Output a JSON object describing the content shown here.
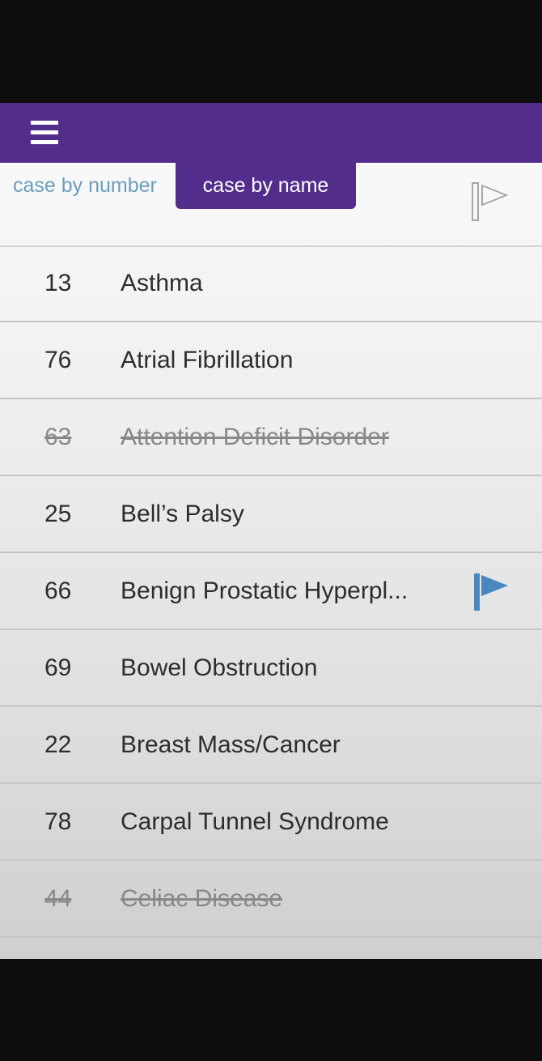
{
  "header": {
    "menu_icon": "hamburger-menu-icon",
    "bar_color": "#532d8c"
  },
  "tabs": {
    "by_number_label": "case by number",
    "by_name_label": "case by name",
    "active": "case by name",
    "filter_icon": "flag-outline-icon"
  },
  "cases": [
    {
      "number": "13",
      "name": "Asthma",
      "completed": false,
      "flagged": false
    },
    {
      "number": "76",
      "name": "Atrial Fibrillation",
      "completed": false,
      "flagged": false
    },
    {
      "number": "63",
      "name": "Attention Deficit Disorder",
      "completed": true,
      "flagged": false
    },
    {
      "number": "25",
      "name": "Bell’s Palsy",
      "completed": false,
      "flagged": false
    },
    {
      "number": "66",
      "name": "Benign Prostatic Hyperpl...",
      "completed": false,
      "flagged": true
    },
    {
      "number": "69",
      "name": "Bowel Obstruction",
      "completed": false,
      "flagged": false
    },
    {
      "number": "22",
      "name": "Breast Mass/Cancer",
      "completed": false,
      "flagged": false
    },
    {
      "number": "78",
      "name": "Carpal Tunnel Syndrome",
      "completed": false,
      "flagged": false
    },
    {
      "number": "44",
      "name": "Celiac Disease",
      "completed": true,
      "flagged": false
    }
  ],
  "colors": {
    "accent": "#532d8c",
    "inactive_tab": "#6c9dbd",
    "flag": "#4a86c0"
  }
}
